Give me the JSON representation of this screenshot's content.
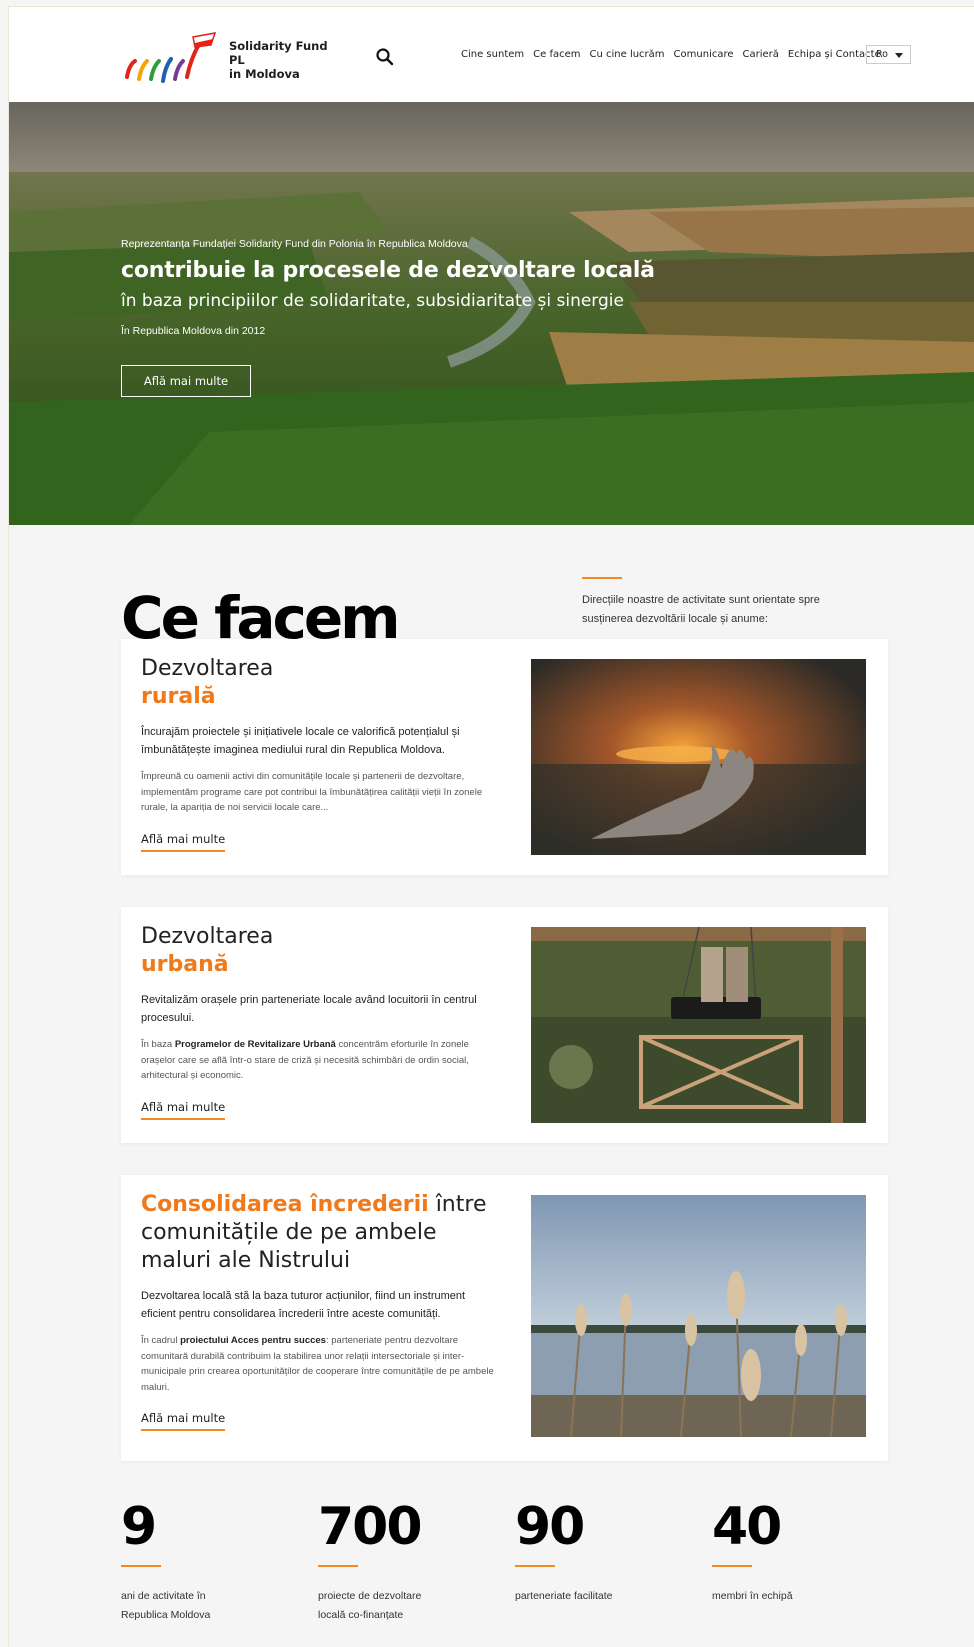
{
  "header": {
    "org_name_line1": "Solidarity Fund PL",
    "org_name_line2": "in Moldova",
    "nav": [
      "Cine suntem",
      "Ce facem",
      "Cu cine lucrăm",
      "Comunicare",
      "Carieră",
      "Echipa și Contacte"
    ],
    "language": "Ro"
  },
  "hero": {
    "pretitle": "Reprezentanța Fundației Solidarity Fund din Polonia în Republica Moldova",
    "title": "contribuie la procesele de dezvoltare locală",
    "subtitle": "în baza principiilor de solidaritate, subsidiaritate și sinergie",
    "since": "În Republica Moldova din 2012",
    "button": "Află mai multe"
  },
  "what_we_do": {
    "title": "Ce facem",
    "intro": "Direcțiile noastre de activitate sunt orientate spre susținerea dezvoltării locale și anume:",
    "cards": [
      {
        "title_plain": "Dezvoltarea",
        "title_accent": "rurală",
        "lead": "Încurajăm proiectele și inițiativele locale ce valorifică potențialul și îmbunătățește imaginea mediului rural din Republica Moldova.",
        "body": "Împreună cu oamenii activi din comunitățile locale și partenerii de dezvoltare, implementăm programe care pot contribui la îmbunătățirea calității vieții în zonele rurale, la apariția de noi servicii locale care...",
        "link": "Află mai multe"
      },
      {
        "title_plain": "Dezvoltarea",
        "title_accent": "urbană",
        "lead": "Revitalizăm orașele prin parteneriate locale având locuitorii în centrul procesului.",
        "body_prefix": "În baza ",
        "body_bold": "Programelor de Revitalizare Urbană",
        "body_suffix": " concentrăm eforturile în zonele orașelor care se află într-o stare de criză și necesită schimbări de ordin social, arhitectural și economic.",
        "link": "Află mai multe"
      },
      {
        "title_accent": "Consolidarea încrederii",
        "title_plain": " între comunitățile de pe ambele maluri ale Nistrului",
        "lead": "Dezvoltarea locală stă la baza tuturor acțiunilor, fiind un instrument eficient pentru consolidarea încrederii între aceste comunități.",
        "body_prefix": "În cadrul ",
        "body_bold": "proiectului Acces pentru succes",
        "body_suffix": ": parteneriate pentru dezvoltare comunitară durabilă contribuim la stabilirea unor relații intersectoriale și inter-municipale prin crearea oportunităților de cooperare între comunitățile de pe ambele maluri.",
        "link": "Află mai multe"
      }
    ]
  },
  "stats": [
    {
      "value": "9",
      "label_line1": "ani de activitate în",
      "label_line2": "Republica Moldova"
    },
    {
      "value": "700",
      "label_line1": "proiecte de dezvoltare",
      "label_line2": "locală co-finanțate"
    },
    {
      "value": "90",
      "label_line1": "parteneriate facilitate",
      "label_line2": ""
    },
    {
      "value": "40",
      "label_line1": "membri în echipă",
      "label_line2": ""
    }
  ],
  "colors": {
    "accent": "#f07a1a",
    "text": "#222222",
    "background": "#f5f5f5"
  }
}
